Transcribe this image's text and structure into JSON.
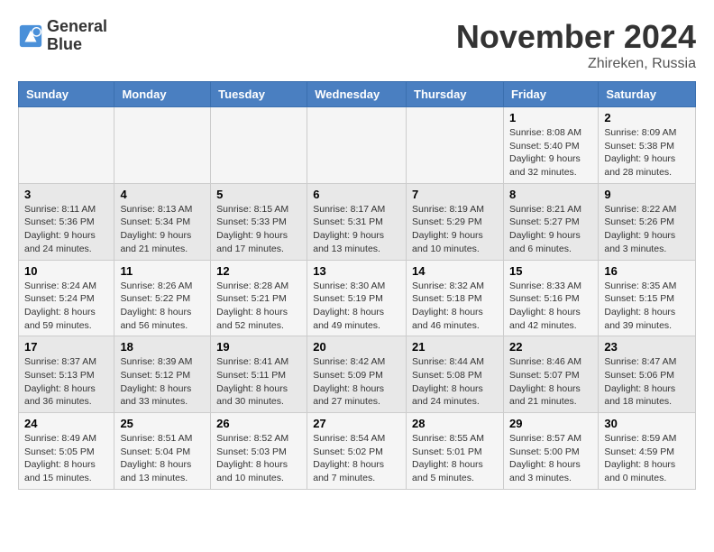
{
  "header": {
    "logo_line1": "General",
    "logo_line2": "Blue",
    "title": "November 2024",
    "location": "Zhireken, Russia"
  },
  "days_of_week": [
    "Sunday",
    "Monday",
    "Tuesday",
    "Wednesday",
    "Thursday",
    "Friday",
    "Saturday"
  ],
  "weeks": [
    [
      {
        "day": "",
        "sunrise": "",
        "sunset": "",
        "daylight": ""
      },
      {
        "day": "",
        "sunrise": "",
        "sunset": "",
        "daylight": ""
      },
      {
        "day": "",
        "sunrise": "",
        "sunset": "",
        "daylight": ""
      },
      {
        "day": "",
        "sunrise": "",
        "sunset": "",
        "daylight": ""
      },
      {
        "day": "",
        "sunrise": "",
        "sunset": "",
        "daylight": ""
      },
      {
        "day": "1",
        "sunrise": "8:08 AM",
        "sunset": "5:40 PM",
        "daylight": "9 hours and 32 minutes."
      },
      {
        "day": "2",
        "sunrise": "8:09 AM",
        "sunset": "5:38 PM",
        "daylight": "9 hours and 28 minutes."
      }
    ],
    [
      {
        "day": "3",
        "sunrise": "8:11 AM",
        "sunset": "5:36 PM",
        "daylight": "9 hours and 24 minutes."
      },
      {
        "day": "4",
        "sunrise": "8:13 AM",
        "sunset": "5:34 PM",
        "daylight": "9 hours and 21 minutes."
      },
      {
        "day": "5",
        "sunrise": "8:15 AM",
        "sunset": "5:33 PM",
        "daylight": "9 hours and 17 minutes."
      },
      {
        "day": "6",
        "sunrise": "8:17 AM",
        "sunset": "5:31 PM",
        "daylight": "9 hours and 13 minutes."
      },
      {
        "day": "7",
        "sunrise": "8:19 AM",
        "sunset": "5:29 PM",
        "daylight": "9 hours and 10 minutes."
      },
      {
        "day": "8",
        "sunrise": "8:21 AM",
        "sunset": "5:27 PM",
        "daylight": "9 hours and 6 minutes."
      },
      {
        "day": "9",
        "sunrise": "8:22 AM",
        "sunset": "5:26 PM",
        "daylight": "9 hours and 3 minutes."
      }
    ],
    [
      {
        "day": "10",
        "sunrise": "8:24 AM",
        "sunset": "5:24 PM",
        "daylight": "8 hours and 59 minutes."
      },
      {
        "day": "11",
        "sunrise": "8:26 AM",
        "sunset": "5:22 PM",
        "daylight": "8 hours and 56 minutes."
      },
      {
        "day": "12",
        "sunrise": "8:28 AM",
        "sunset": "5:21 PM",
        "daylight": "8 hours and 52 minutes."
      },
      {
        "day": "13",
        "sunrise": "8:30 AM",
        "sunset": "5:19 PM",
        "daylight": "8 hours and 49 minutes."
      },
      {
        "day": "14",
        "sunrise": "8:32 AM",
        "sunset": "5:18 PM",
        "daylight": "8 hours and 46 minutes."
      },
      {
        "day": "15",
        "sunrise": "8:33 AM",
        "sunset": "5:16 PM",
        "daylight": "8 hours and 42 minutes."
      },
      {
        "day": "16",
        "sunrise": "8:35 AM",
        "sunset": "5:15 PM",
        "daylight": "8 hours and 39 minutes."
      }
    ],
    [
      {
        "day": "17",
        "sunrise": "8:37 AM",
        "sunset": "5:13 PM",
        "daylight": "8 hours and 36 minutes."
      },
      {
        "day": "18",
        "sunrise": "8:39 AM",
        "sunset": "5:12 PM",
        "daylight": "8 hours and 33 minutes."
      },
      {
        "day": "19",
        "sunrise": "8:41 AM",
        "sunset": "5:11 PM",
        "daylight": "8 hours and 30 minutes."
      },
      {
        "day": "20",
        "sunrise": "8:42 AM",
        "sunset": "5:09 PM",
        "daylight": "8 hours and 27 minutes."
      },
      {
        "day": "21",
        "sunrise": "8:44 AM",
        "sunset": "5:08 PM",
        "daylight": "8 hours and 24 minutes."
      },
      {
        "day": "22",
        "sunrise": "8:46 AM",
        "sunset": "5:07 PM",
        "daylight": "8 hours and 21 minutes."
      },
      {
        "day": "23",
        "sunrise": "8:47 AM",
        "sunset": "5:06 PM",
        "daylight": "8 hours and 18 minutes."
      }
    ],
    [
      {
        "day": "24",
        "sunrise": "8:49 AM",
        "sunset": "5:05 PM",
        "daylight": "8 hours and 15 minutes."
      },
      {
        "day": "25",
        "sunrise": "8:51 AM",
        "sunset": "5:04 PM",
        "daylight": "8 hours and 13 minutes."
      },
      {
        "day": "26",
        "sunrise": "8:52 AM",
        "sunset": "5:03 PM",
        "daylight": "8 hours and 10 minutes."
      },
      {
        "day": "27",
        "sunrise": "8:54 AM",
        "sunset": "5:02 PM",
        "daylight": "8 hours and 7 minutes."
      },
      {
        "day": "28",
        "sunrise": "8:55 AM",
        "sunset": "5:01 PM",
        "daylight": "8 hours and 5 minutes."
      },
      {
        "day": "29",
        "sunrise": "8:57 AM",
        "sunset": "5:00 PM",
        "daylight": "8 hours and 3 minutes."
      },
      {
        "day": "30",
        "sunrise": "8:59 AM",
        "sunset": "4:59 PM",
        "daylight": "8 hours and 0 minutes."
      }
    ]
  ]
}
